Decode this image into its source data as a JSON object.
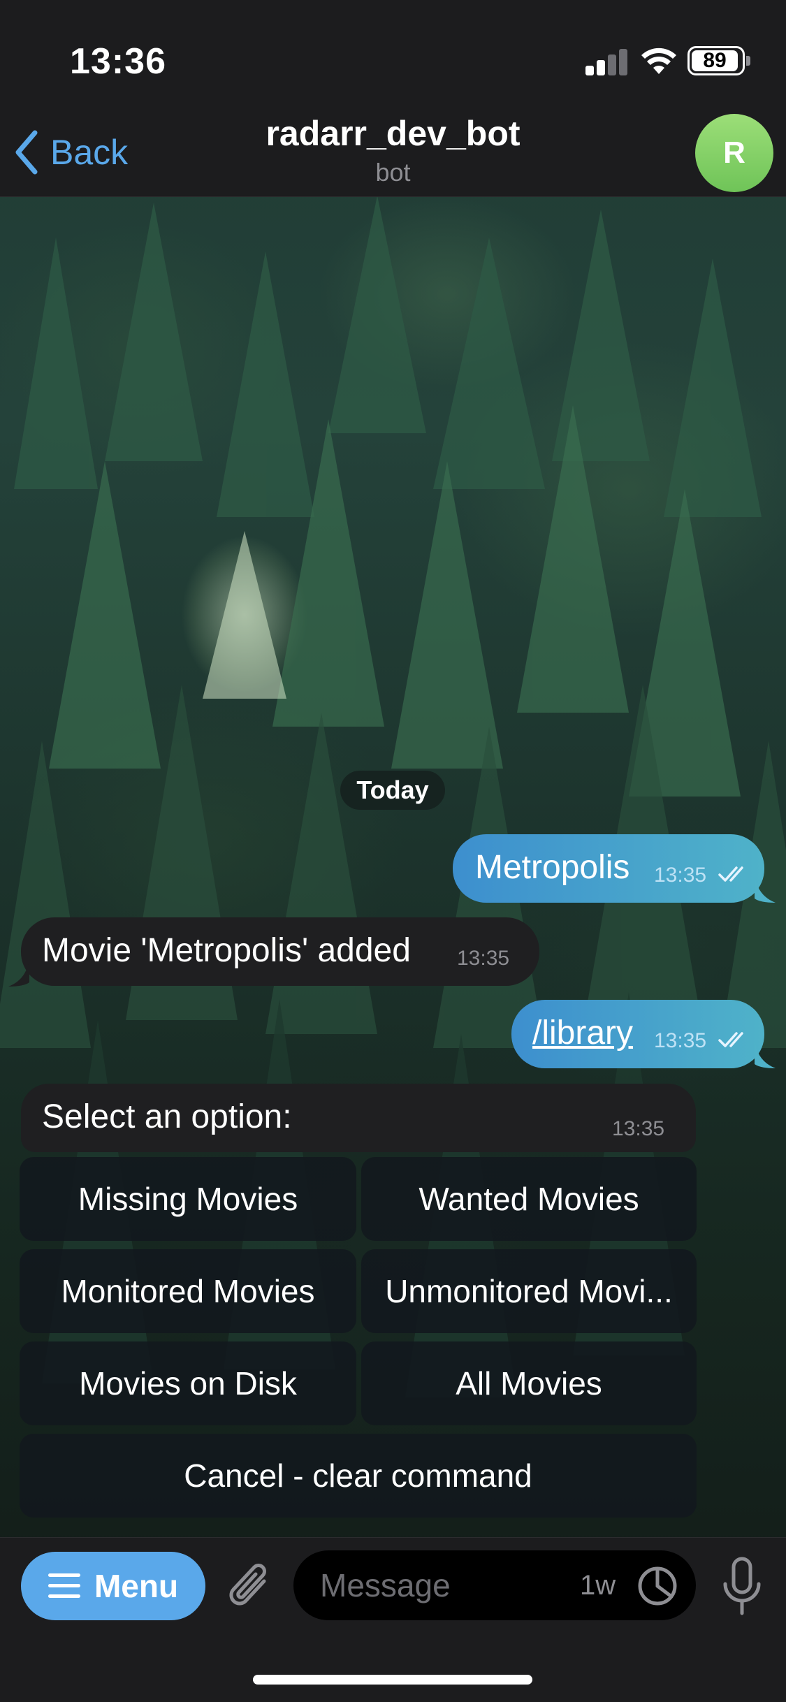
{
  "status_bar": {
    "time": "13:36",
    "battery": "89"
  },
  "nav": {
    "back_label": "Back",
    "title": "radarr_dev_bot",
    "subtitle": "bot",
    "avatar_letter": "R",
    "avatar_color": "#7ed067"
  },
  "chat": {
    "date_separator": "Today",
    "messages": [
      {
        "direction": "out",
        "text": "Metropolis",
        "time": "13:35",
        "status": "read"
      },
      {
        "direction": "in",
        "text": "Movie 'Metropolis' added",
        "time": "13:35"
      },
      {
        "direction": "out",
        "text": "/library",
        "time": "13:35",
        "status": "read"
      },
      {
        "direction": "in",
        "text": "Select an option:",
        "time": "13:35"
      }
    ],
    "keyboard": [
      "Missing Movies",
      "Wanted Movies",
      "Monitored Movies",
      "Unmonitored Movi...",
      "Movies on Disk",
      "All Movies",
      "Cancel - clear command"
    ]
  },
  "input_bar": {
    "menu_label": "Menu",
    "placeholder": "Message",
    "timer_label": "1w"
  },
  "colors": {
    "accent": "#5aa8ea",
    "outgoing_bubble": "#4aa3cc",
    "incoming_bubble": "#1f1f21",
    "bar_background": "#1c1c1e"
  }
}
